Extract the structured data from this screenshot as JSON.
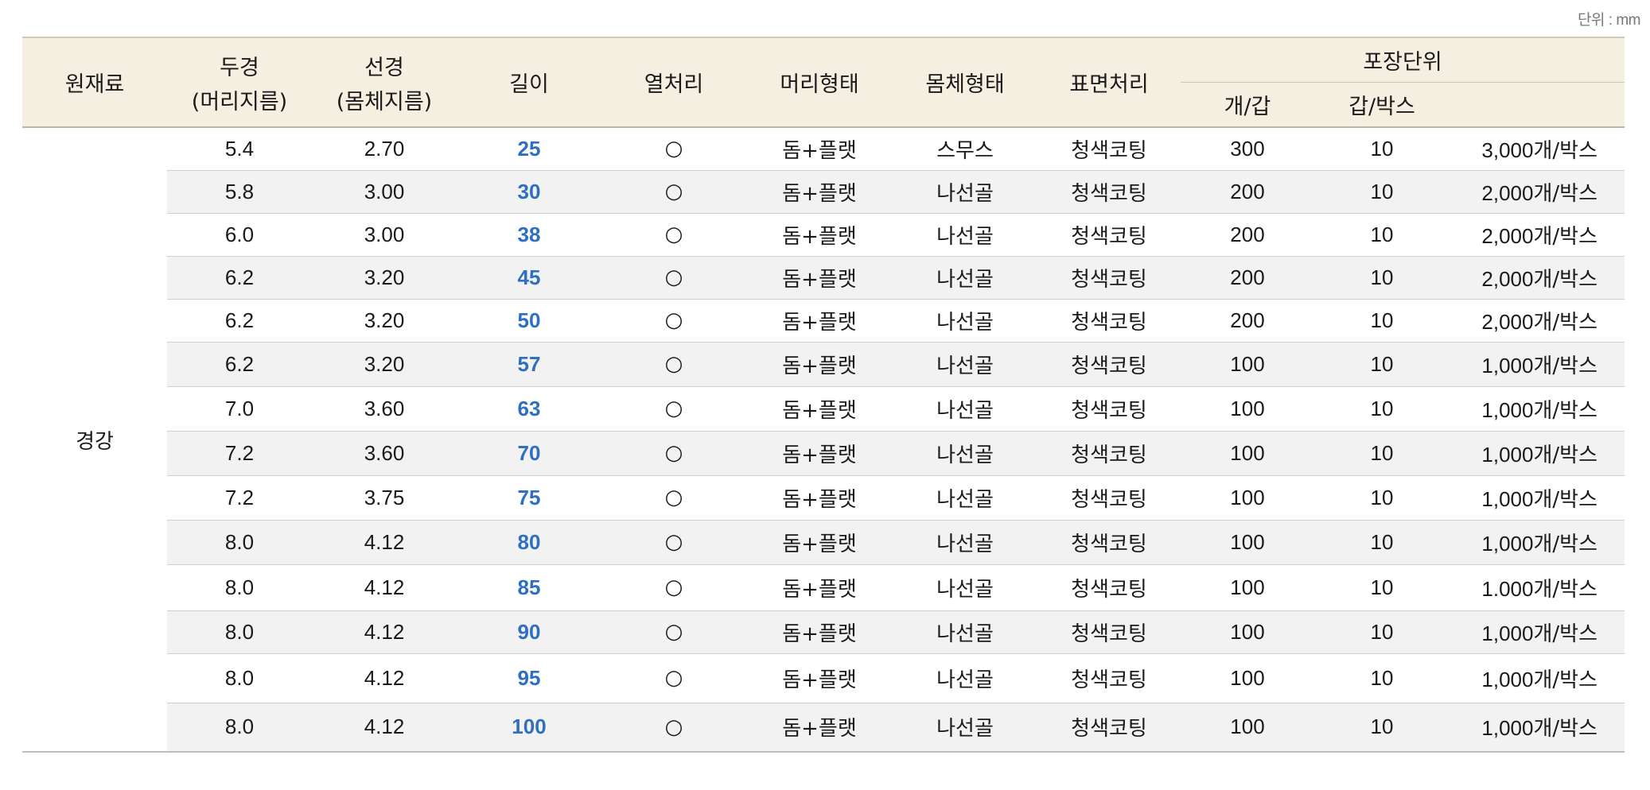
{
  "unit_note": "단위 : mm",
  "headers": {
    "material": "원재료",
    "head_dia": "두경",
    "head_dia_sub": "(머리지름)",
    "body_dia": "선경",
    "body_dia_sub": "(몸체지름)",
    "length": "길이",
    "heat_treatment": "열처리",
    "head_type": "머리형태",
    "body_type": "몸체형태",
    "surface": "표면처리",
    "packaging": "포장단위",
    "pcs_per_pack": "개/갑",
    "packs_per_box": "갑/박스"
  },
  "material_value": "경강",
  "rows": [
    {
      "head": "5.4",
      "body": "2.70",
      "length": "25",
      "heat": "○",
      "head_type": "돔+플랫",
      "body_type": "스무스",
      "surface": "청색코팅",
      "pcs": "300",
      "packs": "10",
      "total_num": "3,000",
      "total_unit": "개/박스"
    },
    {
      "head": "5.8",
      "body": "3.00",
      "length": "30",
      "heat": "○",
      "head_type": "돔+플랫",
      "body_type": "나선골",
      "surface": "청색코팅",
      "pcs": "200",
      "packs": "10",
      "total_num": "2,000",
      "total_unit": "개/박스"
    },
    {
      "head": "6.0",
      "body": "3.00",
      "length": "38",
      "heat": "○",
      "head_type": "돔+플랫",
      "body_type": "나선골",
      "surface": "청색코팅",
      "pcs": "200",
      "packs": "10",
      "total_num": "2,000",
      "total_unit": "개/박스"
    },
    {
      "head": "6.2",
      "body": "3.20",
      "length": "45",
      "heat": "○",
      "head_type": "돔+플랫",
      "body_type": "나선골",
      "surface": "청색코팅",
      "pcs": "200",
      "packs": "10",
      "total_num": "2,000",
      "total_unit": "개/박스"
    },
    {
      "head": "6.2",
      "body": "3.20",
      "length": "50",
      "heat": "○",
      "head_type": "돔+플랫",
      "body_type": "나선골",
      "surface": "청색코팅",
      "pcs": "200",
      "packs": "10",
      "total_num": "2,000",
      "total_unit": "개/박스"
    },
    {
      "head": "6.2",
      "body": "3.20",
      "length": "57",
      "heat": "○",
      "head_type": "돔+플랫",
      "body_type": "나선골",
      "surface": "청색코팅",
      "pcs": "100",
      "packs": "10",
      "total_num": "1,000",
      "total_unit": "개/박스"
    },
    {
      "head": "7.0",
      "body": "3.60",
      "length": "63",
      "heat": "○",
      "head_type": "돔+플랫",
      "body_type": "나선골",
      "surface": "청색코팅",
      "pcs": "100",
      "packs": "10",
      "total_num": "1,000",
      "total_unit": "개/박스"
    },
    {
      "head": "7.2",
      "body": "3.60",
      "length": "70",
      "heat": "○",
      "head_type": "돔+플랫",
      "body_type": "나선골",
      "surface": "청색코팅",
      "pcs": "100",
      "packs": "10",
      "total_num": "1,000",
      "total_unit": "개/박스"
    },
    {
      "head": "7.2",
      "body": "3.75",
      "length": "75",
      "heat": "○",
      "head_type": "돔+플랫",
      "body_type": "나선골",
      "surface": "청색코팅",
      "pcs": "100",
      "packs": "10",
      "total_num": "1,000",
      "total_unit": "개/박스"
    },
    {
      "head": "8.0",
      "body": "4.12",
      "length": "80",
      "heat": "○",
      "head_type": "돔+플랫",
      "body_type": "나선골",
      "surface": "청색코팅",
      "pcs": "100",
      "packs": "10",
      "total_num": "1,000",
      "total_unit": "개/박스"
    },
    {
      "head": "8.0",
      "body": "4.12",
      "length": "85",
      "heat": "○",
      "head_type": "돔+플랫",
      "body_type": "나선골",
      "surface": "청색코팅",
      "pcs": "100",
      "packs": "10",
      "total_num": "1.000",
      "total_unit": "개/박스"
    },
    {
      "head": "8.0",
      "body": "4.12",
      "length": "90",
      "heat": "○",
      "head_type": "돔+플랫",
      "body_type": "나선골",
      "surface": "청색코팅",
      "pcs": "100",
      "packs": "10",
      "total_num": "1,000",
      "total_unit": "개/박스"
    },
    {
      "head": "8.0",
      "body": "4.12",
      "length": "95",
      "heat": "○",
      "head_type": "돔+플랫",
      "body_type": "나선골",
      "surface": "청색코팅",
      "pcs": "100",
      "packs": "10",
      "total_num": "1,000",
      "total_unit": "개/박스"
    },
    {
      "head": "8.0",
      "body": "4.12",
      "length": "100",
      "heat": "○",
      "head_type": "돔+플랫",
      "body_type": "나선골",
      "surface": "청색코팅",
      "pcs": "100",
      "packs": "10",
      "total_num": "1,000",
      "total_unit": "개/박스"
    }
  ],
  "colors": {
    "header_bg": "#f5efe2",
    "alt_row_bg": "#f2f2f2",
    "length_text": "#2f6fc0"
  }
}
